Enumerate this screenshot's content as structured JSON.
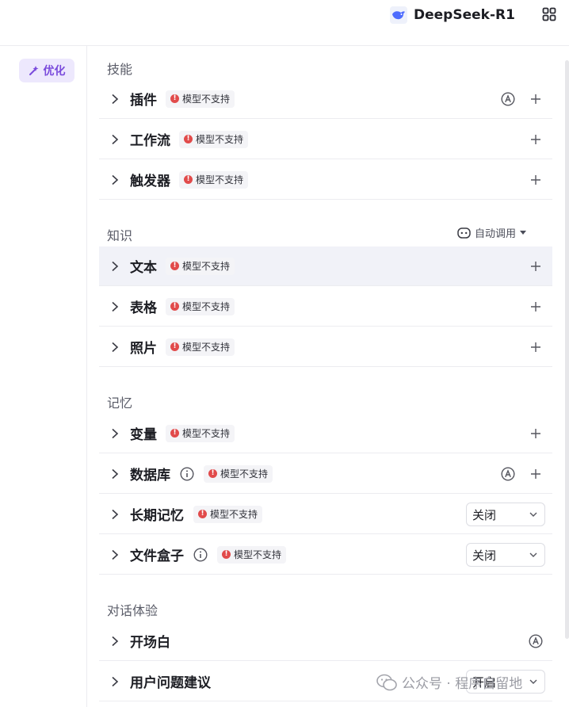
{
  "header": {
    "model_name": "DeepSeek-R1"
  },
  "sidebar": {
    "optimize_label": "优化"
  },
  "badge_text": "模型不支持",
  "sections": {
    "skills": {
      "title": "技能",
      "rows": {
        "plugin": "插件",
        "workflow": "工作流",
        "trigger": "触发器"
      }
    },
    "knowledge": {
      "title": "知识",
      "auto_call": "自动调用",
      "rows": {
        "text": "文本",
        "table": "表格",
        "photo": "照片"
      }
    },
    "memory": {
      "title": "记忆",
      "rows": {
        "variable": "变量",
        "database": "数据库",
        "long_memory": "长期记忆",
        "file_box": "文件盒子"
      },
      "long_memory_value": "关闭",
      "file_box_value": "关闭"
    },
    "chat": {
      "title": "对话体验",
      "rows": {
        "opening": "开场白",
        "suggestion": "用户问题建议"
      },
      "suggestion_value": "开启"
    }
  },
  "watermark": "公众号 · 程序自留地",
  "colors": {
    "accent_purple": "#7a4bdc",
    "badge_red": "#e14b4b",
    "active_row_bg": "#f1f2f8"
  },
  "icons": {
    "row_expand": "chevron-right-icon",
    "add": "plus-icon",
    "auto": "circle-a-icon",
    "info": "info-icon",
    "grid": "grid-icon"
  }
}
